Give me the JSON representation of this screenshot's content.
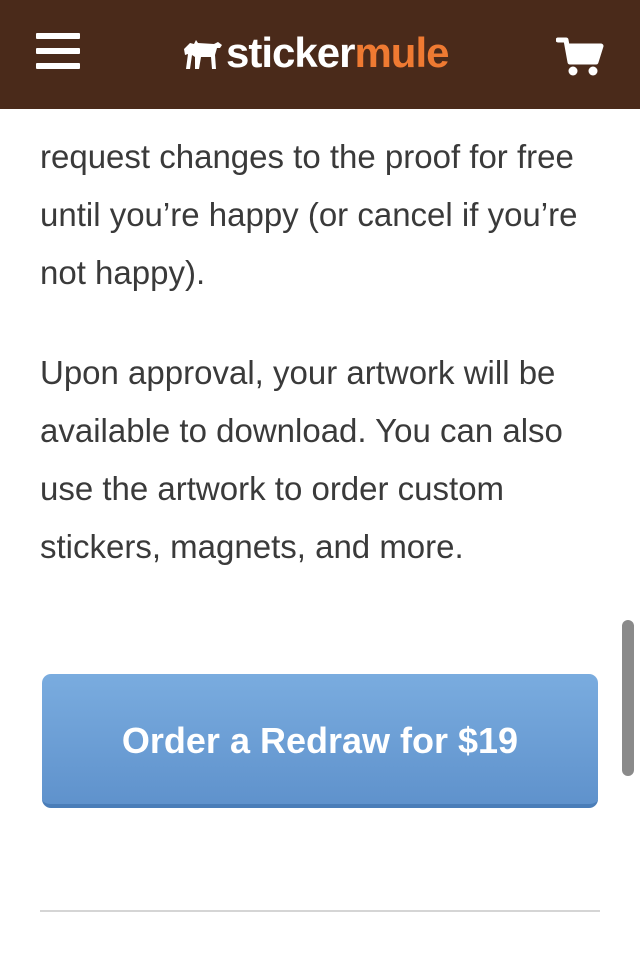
{
  "header": {
    "logo_part_1": "sticker",
    "logo_part_2": "mule",
    "menu_icon": "hamburger-menu-icon",
    "cart_icon": "shopping-cart-icon",
    "colors": {
      "bar": "#4a2a1a",
      "logo_accent": "#ef7a32"
    }
  },
  "content": {
    "paragraph_1": "request changes to the proof for free until you’re happy (or cancel if you’re not happy).",
    "paragraph_2": "Upon approval, your artwork will be available to download. You can also use the artwork to order custom stickers, magnets, and more."
  },
  "cta": {
    "label": "Order a Redraw for $19",
    "color": "#6a9fd8"
  }
}
